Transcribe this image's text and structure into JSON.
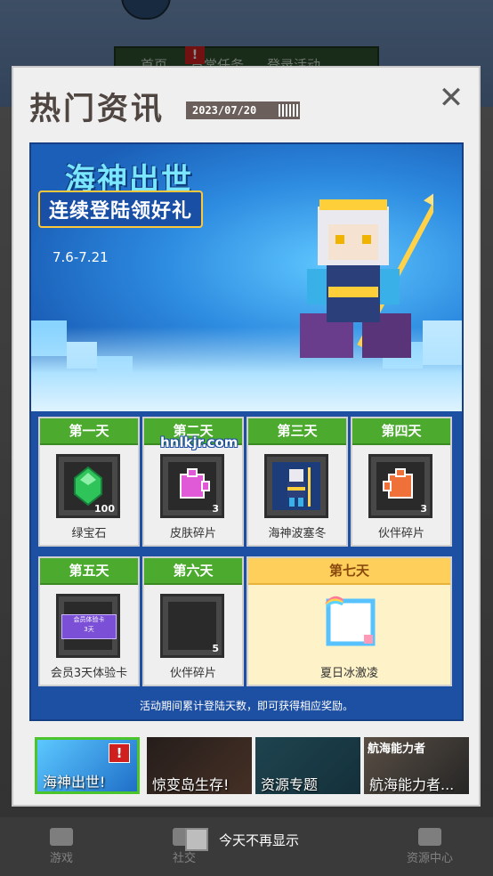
{
  "background": {
    "tabs": [
      "首页",
      "日常任务",
      "登录活动"
    ],
    "tab_badge": "!",
    "bottom_nav": [
      "游戏",
      "社交",
      "资源中心"
    ]
  },
  "modal": {
    "title": "热门资讯",
    "date": "2023/07/20",
    "close_icon": "close-icon"
  },
  "banner": {
    "title": "海神出世",
    "subtitle": "连续登陆领好礼",
    "date_range": "7.6-7.21"
  },
  "days": [
    {
      "day": "第一天",
      "item": "绿宝石",
      "count": "100",
      "icon": "emerald-icon"
    },
    {
      "day": "第二天",
      "item": "皮肤碎片",
      "count": "3",
      "icon": "skin-fragment-icon"
    },
    {
      "day": "第三天",
      "item": "海神波塞冬",
      "count": "",
      "icon": "poseidon-skin-icon"
    },
    {
      "day": "第四天",
      "item": "伙伴碎片",
      "count": "3",
      "icon": "partner-fragment-icon"
    },
    {
      "day": "第五天",
      "item": "会员3天体验卡",
      "count": "",
      "icon": "vip-card-icon",
      "card_text": "会员体验卡",
      "card_sub": "3天"
    },
    {
      "day": "第六天",
      "item": "伙伴碎片",
      "count": "5",
      "icon": "partner-fragment-icon"
    },
    {
      "day": "第七天",
      "item": "夏日冰激凌",
      "count": "",
      "icon": "ice-cream-frame-icon"
    }
  ],
  "notice": "活动期间累计登陆天数，即可获得相应奖励。",
  "watermark": "hnlkjr.com",
  "thumbnails": [
    {
      "label": "海神出世!",
      "active": true,
      "badge": "!"
    },
    {
      "label": "惊变岛生存!",
      "active": false
    },
    {
      "label": "资源专题",
      "active": false
    },
    {
      "label": "航海能力者...",
      "active": false,
      "overlay": "航海能力者"
    }
  ],
  "dont_show_label": "今天不再显示",
  "colors": {
    "day_header_green": "#4caa2f",
    "day7_gold": "#ffcf5c",
    "panel_blue": "#1d4fa2",
    "active_thumb_border": "#4cc42c",
    "badge_red": "#d01f1f"
  }
}
